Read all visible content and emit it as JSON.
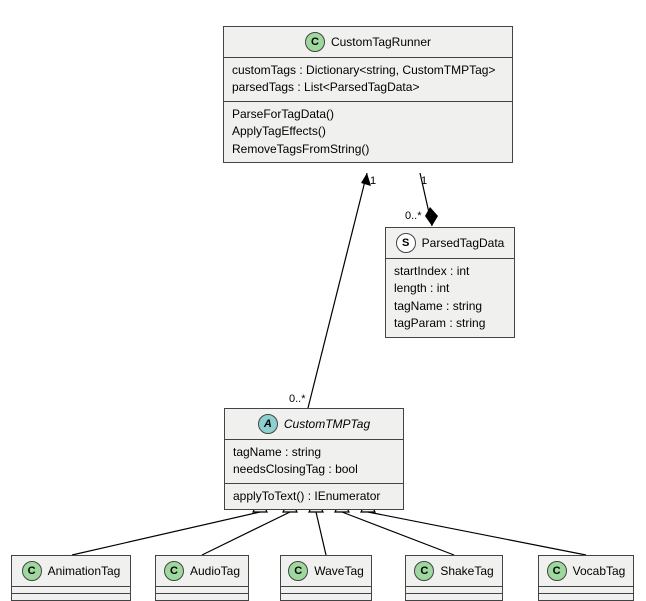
{
  "classes": {
    "ctr": {
      "name": "CustomTagRunner",
      "stereotype": "C",
      "fields": [
        "customTags : Dictionary<string, CustomTMPTag>",
        "parsedTags : List<ParsedTagData>"
      ],
      "methods": [
        "ParseForTagData()",
        "ApplyTagEffects()",
        "RemoveTagsFromString()"
      ]
    },
    "ptd": {
      "name": "ParsedTagData",
      "stereotype": "S",
      "fields": [
        "startIndex : int",
        "length : int",
        "tagName : string",
        "tagParam : string"
      ]
    },
    "ctt": {
      "name": "CustomTMPTag",
      "stereotype": "A",
      "fields": [
        "tagName : string",
        "needsClosingTag : bool"
      ],
      "methods": [
        "applyToText() : IEnumerator"
      ]
    },
    "sub": {
      "AnimationTag": "AnimationTag",
      "AudioTag": "AudioTag",
      "WaveTag": "WaveTag",
      "ShakeTag": "ShakeTag",
      "VocabTag": "VocabTag"
    }
  },
  "mult": {
    "ctr_ctt_top": "1",
    "ctr_ctt_bot": "0..*",
    "ctr_ptd_top": "1",
    "ctr_ptd_bot": "0..*"
  }
}
